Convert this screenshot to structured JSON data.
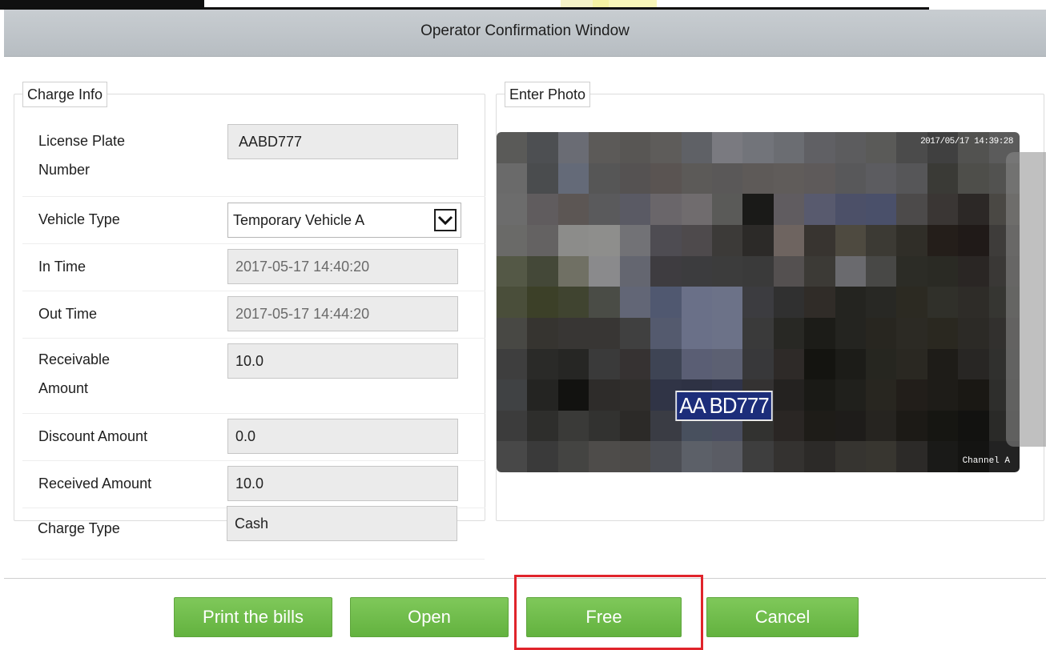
{
  "dialog": {
    "title": "Operator Confirmation Window"
  },
  "charge_info": {
    "legend": "Charge Info",
    "rows": [
      {
        "label_line1": "License Plate",
        "label_line2": "Number",
        "value": "AABD777"
      },
      {
        "label": "Vehicle Type",
        "value": "Temporary Vehicle A"
      },
      {
        "label": "In Time",
        "value": "2017-05-17 14:40:20"
      },
      {
        "label": "Out Time",
        "value": "2017-05-17 14:44:20"
      },
      {
        "label_line1": "Receivable",
        "label_line2": "Amount",
        "value": "10.0"
      },
      {
        "label": "Discount Amount",
        "value": "0.0"
      },
      {
        "label": "Received Amount",
        "value": "10.0"
      },
      {
        "label": "Charge Type",
        "value": "Cash"
      }
    ]
  },
  "enter_photo": {
    "legend": "Enter Photo",
    "timestamp": "2017/05/17  14:39:28",
    "plate_overlay": "AA BD777",
    "channel": "Channel  A"
  },
  "buttons": {
    "print": "Print the bills",
    "open": "Open",
    "free": "Free",
    "cancel": "Cancel"
  },
  "colors": {
    "button_green": "#6cbb47",
    "highlight_red": "#e0242b",
    "titlebar": "#c0c6cb"
  }
}
